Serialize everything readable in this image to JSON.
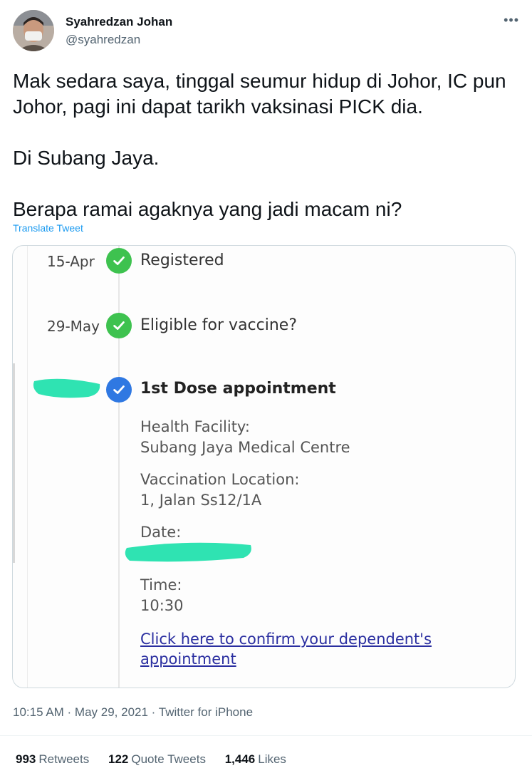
{
  "author": {
    "name": "Syahredzan Johan",
    "handle": "@syahredzan"
  },
  "more_icon": "more-horizontal-icon",
  "tweet_text": "Mak sedara saya, tinggal seumur hidup di Johor, IC pun Johor, pagi ini dapat tarikh vaksinasi PICK dia.\n\nDi Subang Jaya.\n\nBerapa ramai agaknya yang jadi macam ni?",
  "translate_label": "Translate Tweet",
  "media": {
    "steps": [
      {
        "date": "15-Apr",
        "label": "Registered",
        "status": "complete"
      },
      {
        "date": "29-May",
        "label": "Eligible for vaccine?",
        "status": "complete"
      },
      {
        "date": "",
        "label": "1st Dose appointment",
        "status": "current"
      }
    ],
    "details": {
      "facility_label": "Health Facility:",
      "facility_value": "Subang Jaya Medical Centre",
      "location_label": "Vaccination Location:",
      "location_value": "1, Jalan Ss12/1A",
      "date_label": "Date:",
      "time_label": "Time:",
      "time_value": "10:30"
    },
    "link_text": "Click here to confirm your dependent's appointment"
  },
  "meta": "10:15 AM · May 29, 2021 · Twitter for iPhone",
  "stats": {
    "retweets_count": "993",
    "retweets_label": "Retweets",
    "quotes_count": "122",
    "quotes_label": "Quote Tweets",
    "likes_count": "1,446",
    "likes_label": "Likes"
  },
  "colors": {
    "accent": "#1d9bf0",
    "check_green": "#3ec24f",
    "check_blue": "#2f78e2",
    "redaction": "#2fe3b2"
  }
}
